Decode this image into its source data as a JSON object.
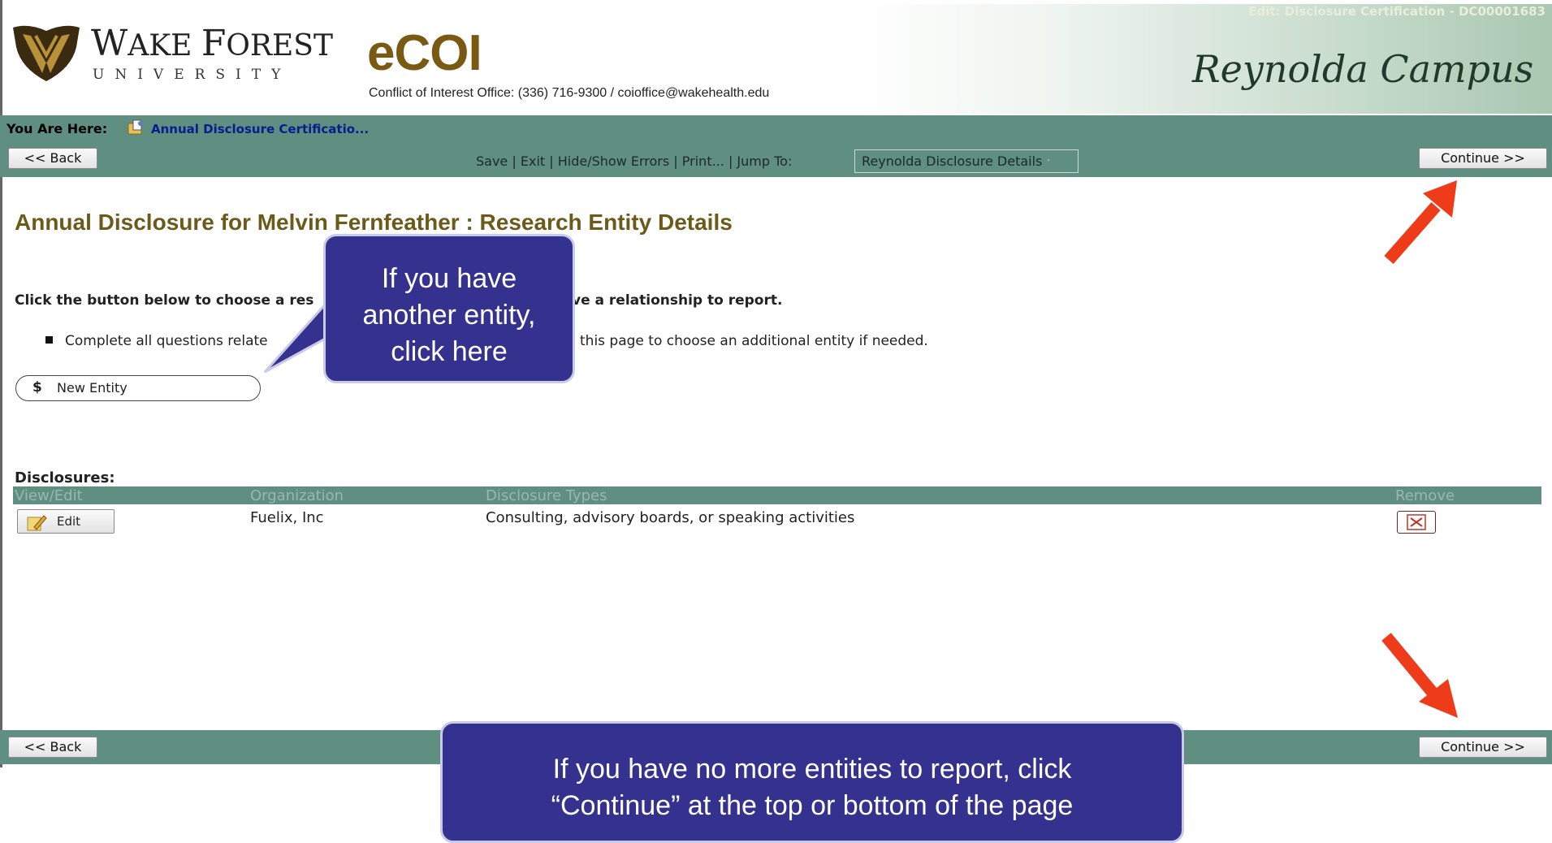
{
  "header": {
    "university_name_big_w": "W",
    "university_name_rest_1": "AKE ",
    "university_name_big_f": "F",
    "university_name_rest_2": "OREST",
    "university_subtitle": "UNIVERSITY",
    "app_name": "eCOI",
    "office_contact": "Conflict of Interest Office: (336) 716-9300 / coioffice@wakehealth.edu",
    "edit_title": "Edit: Disclosure Certification - DC00001683",
    "campus": "Reynolda Campus"
  },
  "breadcrumb": {
    "label": "You Are Here:",
    "link": "Annual Disclosure Certificatio..."
  },
  "toolbar": {
    "back_label": "<< Back",
    "save": "Save",
    "exit": "Exit",
    "hide_show_errors": "Hide/Show Errors",
    "print": "Print...",
    "jump_to_label": "Jump To:",
    "jump_to_value": "Reynolda Disclosure Details",
    "continue_label": "Continue >>",
    "separator": "|"
  },
  "main": {
    "title": "Annual Disclosure for Melvin Fernfeather : Research Entity Details",
    "instruction_part1": "Click the button below to choose a res",
    "instruction_part2": "ve a relationship to report.",
    "bullet_part1": "Complete all questions relate",
    "bullet_part2": "this page to choose an additional entity if needed.",
    "new_entity_label": "New Entity",
    "dollar_icon": "$",
    "disclosures_label": "Disclosures:"
  },
  "table": {
    "headers": [
      "View/Edit",
      "Organization",
      "Disclosure Types",
      "Remove"
    ],
    "rows": [
      {
        "edit_label": "Edit",
        "organization": "Fuelix, Inc",
        "types": "Consulting, advisory boards, or speaking activities"
      }
    ]
  },
  "bottom": {
    "back_label": "<< Back",
    "continue_label": "Continue >>"
  },
  "callouts": {
    "top_line1": "If you have",
    "top_line2": "another entity,",
    "top_line3": "click here",
    "bottom_line1": "If you have no more entities to report, click",
    "bottom_line2": "“Continue” at the top or bottom of the page"
  },
  "colors": {
    "bar": "#5e8f80",
    "callout_bg": "#34328e",
    "arrow": "#ee3b1a",
    "title": "#6b5a1a"
  }
}
